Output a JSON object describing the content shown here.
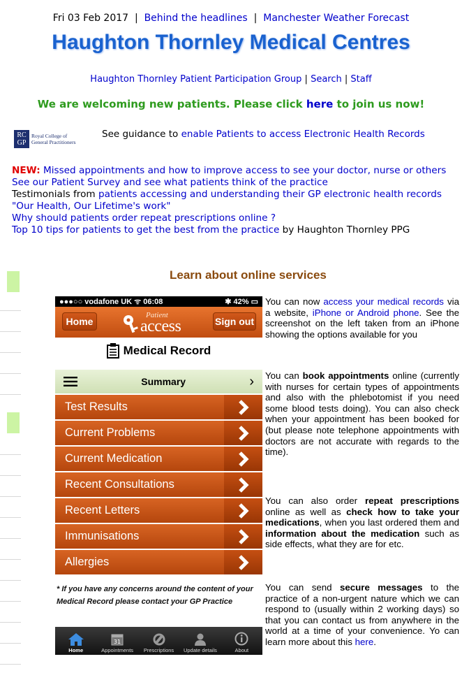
{
  "topbar": {
    "date": "Fri 03 Feb 2017",
    "sep1": "|",
    "link1": "Behind the headlines",
    "sep2": "|",
    "link2": "Manchester Weather Forecast"
  },
  "site_title": "Haughton Thornley Medical Centres",
  "subnav": {
    "ppg": "Haughton Thornley Patient Participation Group",
    "sep1": "|",
    "search": "Search",
    "sep2": "|",
    "staff": "Staff"
  },
  "welcome": {
    "pre": "We are welcoming new patients. Please click",
    "link": "here",
    "post": "to join us now!"
  },
  "rcgp": {
    "mark": "RC GP",
    "line1": "Royal College of",
    "line2": "General Practitioners"
  },
  "guidance": {
    "pre": "See guidance to",
    "link": "enable Patients to access Electronic Health Records"
  },
  "news": {
    "new_tag": "NEW:",
    "item1": "Missed appointments and how to improve access to see your doctor, nurse or others",
    "item2": "See our Patient Survey and see what patients think of the practice",
    "item3_pre": "Testimonials from",
    "item3_link": "patients accessing and understanding their GP electronic health records",
    "item4": "\"Our Health, Our Lifetime's work\"",
    "item5": "Why should patients order repeat prescriptions online ?",
    "item6_link": "Top 10 tips for patients to get the best from the practice",
    "item6_post": "by Haughton Thornley PPG"
  },
  "learn_title": "Learn about online services",
  "phone": {
    "status_left": "●●●○○ vodafone UK ᯤ 06:08",
    "status_right": "✱ 42% ▭",
    "home_btn": "Home",
    "signout_btn": "Sign out",
    "logo_patient": "Patient",
    "logo_access": "access",
    "record_title": "Medical Record",
    "summary_label": "Summary",
    "summary_chev": "›",
    "menu": [
      "Test Results",
      "Current Problems",
      "Current Medication",
      "Recent Consultations",
      "Recent Letters",
      "Immunisations",
      "Allergies"
    ],
    "note": "* If you have any concerns around the content of your Medical Record please contact your GP Practice",
    "tabs": [
      "Home",
      "Appointments",
      "Prescriptions",
      "Update details",
      "About"
    ]
  },
  "info": {
    "p1_pre": "You can now",
    "p1_link1": "access your medical records",
    "p1_mid": "via a website,",
    "p1_link2": "iPhone or Android phone",
    "p1_post": ". See the screenshot on the left taken from an iPhone showing the options available for you",
    "p2_pre": "You can",
    "p2_b1": "book appointments",
    "p2_post": "online (currently with nurses for certain types of appointments and also with the phlebotomist if you need some blood tests doing). You can also check when your appointment has been booked for (but please note telephone appointments with doctors are not accurate with regards to the time).",
    "p3_pre": "You can also order",
    "p3_b1": "repeat prescriptions",
    "p3_mid1": "online as well as",
    "p3_b2": "check how to take your medications",
    "p3_mid2": ", when you last ordered them and",
    "p3_b3": "information about the medication",
    "p3_post": "such as side effects, what they are for etc.",
    "p4_pre": "You can send",
    "p4_b1": "secure messages",
    "p4_mid": "to the practice of a non-urgent nature which we can respond to (usually within 2 working days) so that you can contact us from anywhere in the world at a time of your convenience. Yo can learn more about this",
    "p4_link": "here",
    "p4_end": "."
  },
  "colors": {
    "title_blue": "#1a62cf",
    "link_blue": "#0000cc",
    "welcome_green": "#2e9b1e",
    "new_red": "#e00000",
    "learn_brown": "#8a4a0e",
    "pa_orange": "#c9531a",
    "summary_green": "#d6e6be"
  }
}
